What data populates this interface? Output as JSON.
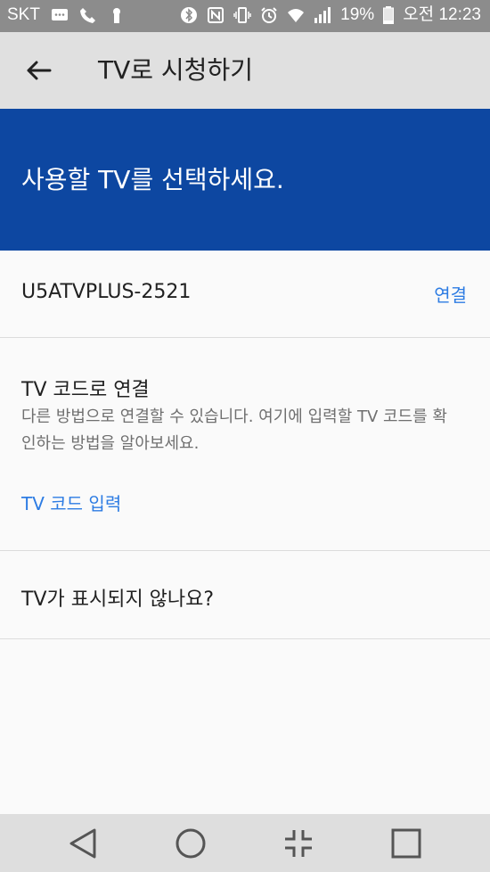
{
  "status_bar": {
    "carrier": "SKT",
    "battery": "19%",
    "time": "오전 12:23",
    "icons": [
      "message-icon",
      "wifi-call-icon",
      "keyhole-icon",
      "bluetooth-icon",
      "nfc-icon",
      "vibrate-icon",
      "alarm-icon",
      "wifi-icon",
      "signal-icon",
      "battery-icon"
    ]
  },
  "appbar": {
    "title": "TV로 시청하기",
    "back_icon": "arrow-left-icon"
  },
  "banner": {
    "heading": "사용할 TV를 선택하세요."
  },
  "devices": [
    {
      "name": "U5ATVPLUS-2521",
      "action": "연결"
    }
  ],
  "tv_code": {
    "heading": "TV 코드로 연결",
    "description": "다른 방법으로 연결할 수 있습니다. 여기에 입력할 TV 코드를 확인하는 방법을 알아보세요.",
    "link": "TV 코드 입력"
  },
  "help": {
    "label": "TV가 표시되지 않나요?"
  },
  "nav_bar": {
    "buttons": [
      "back-triangle-icon",
      "home-circle-icon",
      "split-screen-icon",
      "recents-square-icon"
    ]
  },
  "colors": {
    "status_bar": "#8c8c8c",
    "app_bar": "#e0e0e0",
    "banner": "#0d47a1",
    "link": "#2d7ce3",
    "nav_bar": "#dedede"
  }
}
